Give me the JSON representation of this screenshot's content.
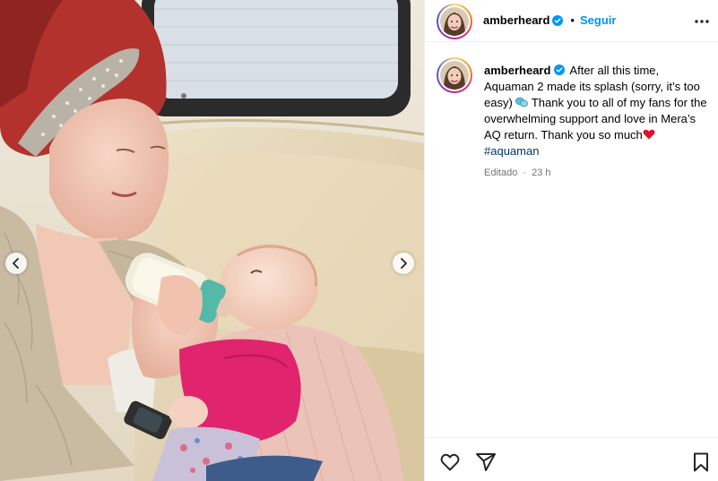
{
  "header": {
    "username": "amberheard",
    "separator": "•",
    "follow_label": "Seguir"
  },
  "caption": {
    "username": "amberheard",
    "text_part1": "After all this time, Aquaman 2 made its splash (sorry, it’s too easy)",
    "text_part2": "Thank you to all of my fans for the overwhelming support and love in Mera’s AQ return. Thank you so much",
    "hashtag": "#aquaman",
    "edited_label": "Editado",
    "separator": "·",
    "time_ago": "23 h"
  },
  "icons": {
    "verified": "verified-badge-icon",
    "more": "more-options-icon",
    "like": "heart-outline-icon",
    "share": "paper-plane-icon",
    "save": "bookmark-outline-icon",
    "carousel_prev": "chevron-left-icon",
    "carousel_next": "chevron-right-icon",
    "emoji_1": "speech-bubbles-emoji",
    "emoji_2": "red-heart-emoji"
  },
  "colors": {
    "link_blue": "#0095f6",
    "hashtag_blue": "#00376b",
    "verified_blue": "#0095f6",
    "meta_gray": "#737373",
    "divider": "#efefef"
  }
}
